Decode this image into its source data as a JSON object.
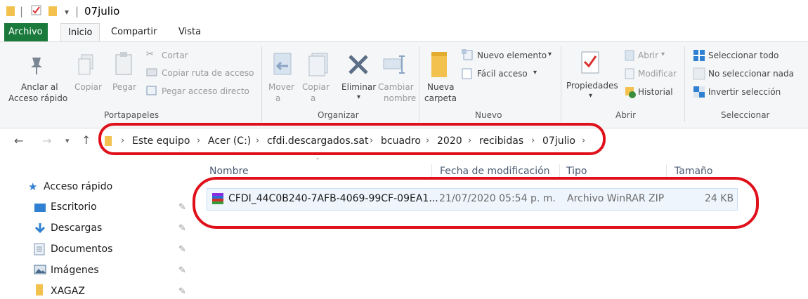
{
  "title_bar": {
    "separator": "|",
    "arrow": "▾",
    "folder_name": "07julio"
  },
  "tabs": [
    "Archivo",
    "Inicio",
    "Compartir",
    "Vista"
  ],
  "ribbon": {
    "portapapeles": {
      "group_label": "Portapapeles",
      "anclar_line1": "Anclar al",
      "anclar_line2": "Acceso rápido",
      "copiar": "Copiar",
      "pegar": "Pegar",
      "cortar": "Cortar",
      "copiar_ruta": "Copiar ruta de acceso",
      "pegar_acceso": "Pegar acceso directo"
    },
    "organizar": {
      "group_label": "Organizar",
      "mover_line1": "Mover",
      "mover_line2": "a",
      "copiar_line1": "Copiar",
      "copiar_line2": "a",
      "eliminar": "Eliminar",
      "cambiar_line1": "Cambiar",
      "cambiar_line2": "nombre"
    },
    "nuevo": {
      "group_label": "Nuevo",
      "nueva_line1": "Nueva",
      "nueva_line2": "carpeta",
      "nuevo_elemento": "Nuevo elemento",
      "facil_acceso": "Fácil acceso"
    },
    "abrir": {
      "group_label": "Abrir",
      "propiedades": "Propiedades",
      "abrir": "Abrir",
      "modificar": "Modificar",
      "historial": "Historial"
    },
    "seleccionar": {
      "group_label": "Seleccionar",
      "todo": "Seleccionar todo",
      "nada": "No seleccionar nada",
      "invertir": "Invertir selección"
    }
  },
  "address_bar": {
    "crumbs": [
      "Este equipo",
      "Acer (C:)",
      "cfdi.descargados.sat",
      "bcuadro",
      "2020",
      "recibidas",
      "07julio"
    ]
  },
  "columns": {
    "name": "Nombre",
    "date": "Fecha de modificación",
    "type": "Tipo",
    "size": "Tamaño"
  },
  "file": {
    "name": "CFDI_44C0B240-7AFB-4069-99CF-09EA1...",
    "date": "21/07/2020 05:54 p. m.",
    "type": "Archivo WinRAR ZIP",
    "size": "24 KB"
  },
  "sidebar": {
    "quick_access": "Acceso rápido",
    "items": [
      "Escritorio",
      "Descargas",
      "Documentos",
      "Imágenes",
      "XAGAZ"
    ]
  },
  "colors": {
    "accent": "#1a7a3c",
    "annotation": "#e0101a",
    "selection": "#eef5fd",
    "folder": "#f2c14e"
  }
}
